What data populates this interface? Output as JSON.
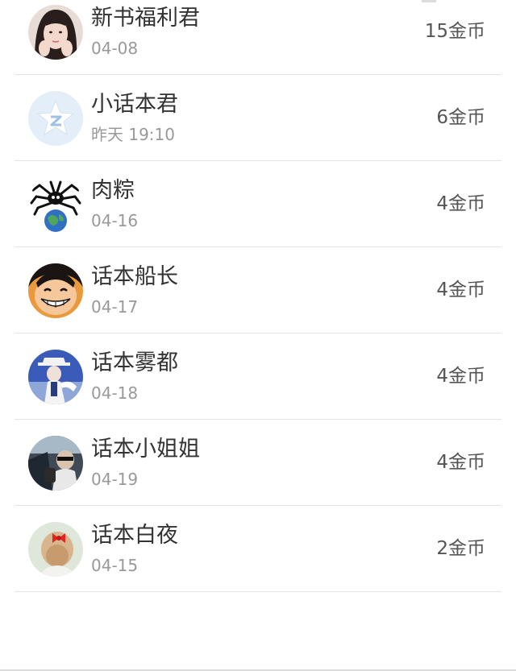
{
  "rows": [
    {
      "name": "新书福利君",
      "date": "04-08",
      "coins": "15金币",
      "avatar": "girl-photo-avatar"
    },
    {
      "name": "小话本君",
      "date": "昨天 19:10",
      "coins": "6金币",
      "avatar": "star-logo-avatar"
    },
    {
      "name": "肉粽",
      "date": "04-16",
      "coins": "4金币",
      "avatar": "spider-globe-avatar"
    },
    {
      "name": "话本船长",
      "date": "04-17",
      "coins": "4金币",
      "avatar": "anime-boy-avatar"
    },
    {
      "name": "话本雾都",
      "date": "04-18",
      "coins": "4金币",
      "avatar": "hat-figure-avatar"
    },
    {
      "name": "话本小姐姐",
      "date": "04-19",
      "coins": "4金币",
      "avatar": "car-photo-avatar"
    },
    {
      "name": "话本白夜",
      "date": "04-15",
      "coins": "2金币",
      "avatar": "bow-girl-avatar"
    }
  ],
  "colors": {
    "name_text": "#333333",
    "date_text": "#999999",
    "coins_text": "#555555",
    "divider": "#e4e4e4"
  }
}
